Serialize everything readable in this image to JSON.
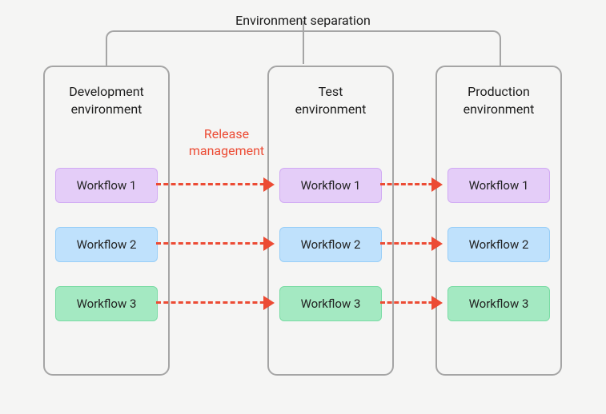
{
  "title": "Environment separation",
  "release_label": "Release\nmanagement",
  "envs": {
    "dev": {
      "title": "Development\nenvironment"
    },
    "test": {
      "title": "Test\nenvironment"
    },
    "prod": {
      "title": "Production\nenvironment"
    }
  },
  "workflows": [
    {
      "label": "Workflow 1",
      "color": "purple"
    },
    {
      "label": "Workflow 2",
      "color": "blue"
    },
    {
      "label": "Workflow 3",
      "color": "green"
    }
  ],
  "colors": {
    "arrow": "#ec4b34",
    "border": "#a5a5a5",
    "purple_bg": "#e4cdf8",
    "blue_bg": "#bfe1fc",
    "green_bg": "#a4e9c2"
  }
}
